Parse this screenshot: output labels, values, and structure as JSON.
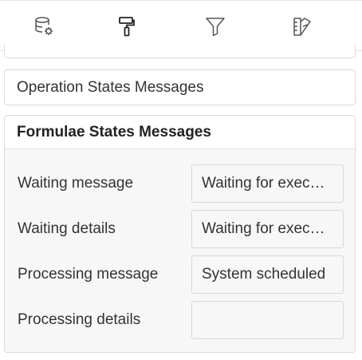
{
  "tabs": [
    {
      "icon": "database-settings-icon"
    },
    {
      "icon": "paint-roller-icon",
      "active": true
    },
    {
      "icon": "filter-icon"
    },
    {
      "icon": "palette-ruler-icon"
    }
  ],
  "sections": {
    "operation_states": {
      "title": "Operation States Messages",
      "expanded": false
    },
    "formulae_states": {
      "title": "Formulae States Messages",
      "expanded": true,
      "fields": [
        {
          "label": "Waiting message",
          "value": "Waiting for execution"
        },
        {
          "label": "Waiting details",
          "value": "Waiting for execution"
        },
        {
          "label": "Processing message",
          "value": "System scheduled"
        },
        {
          "label": "Processing details",
          "value": ""
        }
      ]
    }
  },
  "colors": {
    "active_tab_underline": "#111111",
    "panel_border": "#dcdcdc",
    "panel_body_bg": "#f7f7f7"
  }
}
